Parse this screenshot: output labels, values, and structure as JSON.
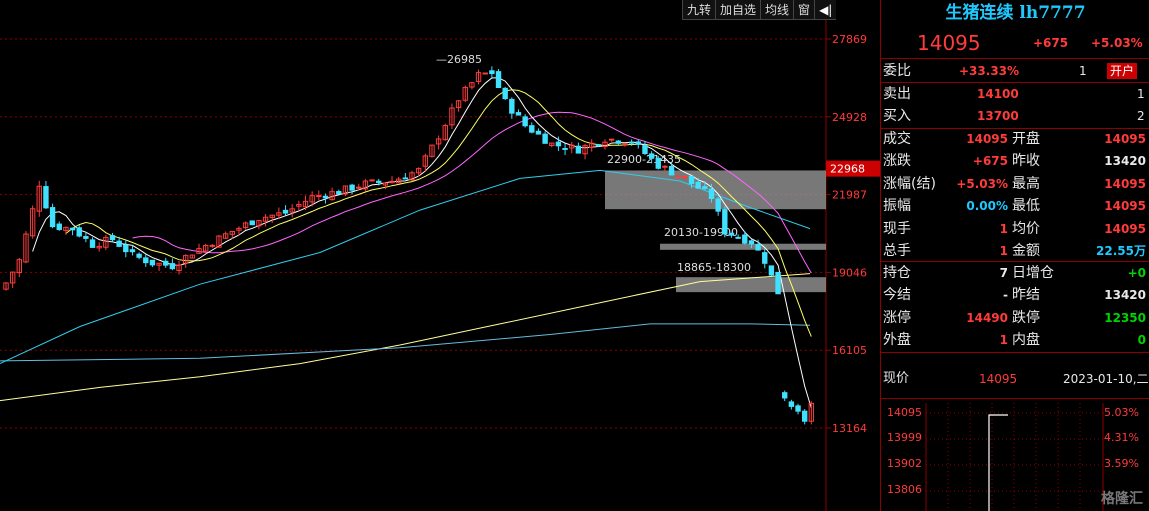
{
  "toolbar": {
    "items": [
      "九转",
      "加自选",
      "均线",
      "窗",
      "◀|"
    ]
  },
  "axis": {
    "ticks": [
      "27869",
      "24928",
      "21987",
      "19046",
      "16105",
      "13164"
    ],
    "current_label": "22968",
    "tick_values": [
      27869,
      24928,
      21987,
      19046,
      16105,
      13164
    ],
    "current_value": 22968
  },
  "annotations": {
    "high": "26985",
    "zones": [
      "22900-21435",
      "20130-19900",
      "18865-18300"
    ]
  },
  "chart_data": {
    "type": "candlestick",
    "title": "生猪连续 lh7777",
    "ylim": [
      12500,
      28800
    ],
    "zones": [
      {
        "label": "22900-21435",
        "low": 21435,
        "high": 22900,
        "start_index": 62
      },
      {
        "label": "20130-19900",
        "low": 19900,
        "high": 20130,
        "start_index": 68
      },
      {
        "label": "18865-18300",
        "low": 18300,
        "high": 18865,
        "start_index": 69
      }
    ],
    "last_close": 14095
  },
  "panel": {
    "title": "生猪连续 lh7777",
    "price": "14095",
    "change": "+675",
    "change_pct": "+5.03%",
    "weibi": {
      "label": "委比",
      "value": "+33.33%",
      "num": "1",
      "badge": "开户"
    },
    "sell": {
      "label": "卖出",
      "price": "14100",
      "vol": "1"
    },
    "buy": {
      "label": "买入",
      "price": "13700",
      "vol": "2"
    },
    "rows": [
      {
        "l1": "成交",
        "v1": "14095",
        "l2": "开盘",
        "v2": "14095"
      },
      {
        "l1": "涨跌",
        "v1": "+675",
        "l2": "昨收",
        "v2": "13420"
      },
      {
        "l1": "涨幅(结)",
        "v1": "+5.03%",
        "l2": "最高",
        "v2": "14095"
      },
      {
        "l1": "振幅",
        "v1": "0.00%",
        "l2": "最低",
        "v2": "14095"
      },
      {
        "l1": "现手",
        "v1": "1",
        "l2": "均价",
        "v2": "14095"
      },
      {
        "l1": "总手",
        "v1": "1",
        "l2": "金额",
        "v2": "22.55万"
      }
    ],
    "rows2": [
      {
        "l1": "持仓",
        "v1": "7",
        "l2": "日增仓",
        "v2": "+0"
      },
      {
        "l1": "今结",
        "v1": "-",
        "l2": "昨结",
        "v2": "13420"
      },
      {
        "l1": "涨停",
        "v1": "14490",
        "l2": "跌停",
        "v2": "12350"
      },
      {
        "l1": "外盘",
        "v1": "1",
        "l2": "内盘",
        "v2": "0"
      }
    ],
    "footer": {
      "label": "现价",
      "price": "14095",
      "date": "2023-01-10,二"
    },
    "mini": {
      "prices": [
        "14095",
        "13999",
        "13902",
        "13806"
      ],
      "pcts": [
        "5.03%",
        "4.31%",
        "3.59%",
        "2.87%"
      ]
    }
  },
  "watermark": "格隆汇",
  "colors": {
    "up": "#ff3b3b",
    "down": "#40e0ff",
    "ma5": "#ffffff",
    "ma10": "#ffff66",
    "ma20": "#ff66ff",
    "ma60": "#33ccee",
    "ma120": "#ffff99",
    "ma250": "#66bbdd"
  }
}
